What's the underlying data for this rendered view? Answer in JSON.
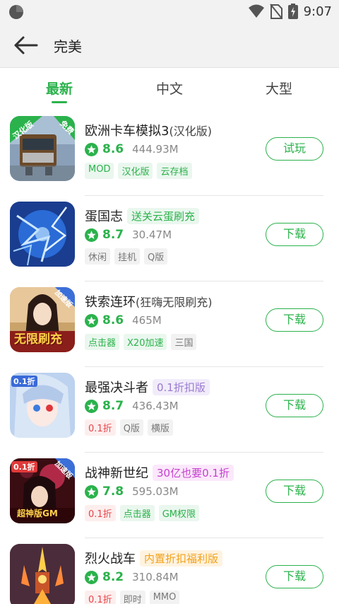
{
  "status_bar": {
    "time": "9:07"
  },
  "header": {
    "title": "完美"
  },
  "tabs": [
    {
      "label": "最新",
      "active": true
    },
    {
      "label": "中文",
      "active": false
    },
    {
      "label": "大型",
      "active": false
    }
  ],
  "colors": {
    "accent": "#2bb24c",
    "tag_red": "#e6454a",
    "tag_grey": "#777777"
  },
  "apps": [
    {
      "name": "欧洲卡车模拟3",
      "name_suffix": "(汉化版)",
      "promo": "",
      "rating": "8.6",
      "size": "444.93M",
      "tags": [
        "MOD",
        "汉化版",
        "云存档"
      ],
      "button": "试玩",
      "icon_badges": {
        "left": "汉化版",
        "right": "免费"
      }
    },
    {
      "name": "蛋国志",
      "name_suffix": "",
      "promo": "送关云蛋刷充",
      "rating": "8.7",
      "size": "30.47M",
      "tags": [
        "休闲",
        "挂机",
        "Q版"
      ],
      "button": "下载",
      "icon_badges": {}
    },
    {
      "name": "铁索连环",
      "name_suffix": "(狂嗨无限刷充)",
      "promo": "",
      "rating": "8.6",
      "size": "465M",
      "tags": [
        "点击器",
        "X20加速",
        "三国"
      ],
      "button": "下载",
      "icon_badges": {
        "right": "加速版",
        "bottom": "无限刷充"
      }
    },
    {
      "name": "最强决斗者",
      "name_suffix": "",
      "promo": "0.1折扣版",
      "rating": "8.7",
      "size": "436.43M",
      "tags": [
        "0.1折",
        "Q版",
        "横版"
      ],
      "button": "下载",
      "icon_badges": {
        "left": "0.1折"
      }
    },
    {
      "name": "战神新世纪",
      "name_suffix": "",
      "promo": "30亿也要0.1折",
      "rating": "7.8",
      "size": "595.03M",
      "tags": [
        "0.1折",
        "点击器",
        "GM权限"
      ],
      "button": "下载",
      "icon_badges": {
        "left": "0.1折",
        "right": "加速版",
        "bottom": "超神版GM"
      }
    },
    {
      "name": "烈火战车",
      "name_suffix": "",
      "promo": "内置折扣福利版",
      "rating": "8.2",
      "size": "310.84M",
      "tags": [
        "0.1折",
        "即时",
        "MMO"
      ],
      "button": "下载",
      "icon_badges": {}
    }
  ]
}
